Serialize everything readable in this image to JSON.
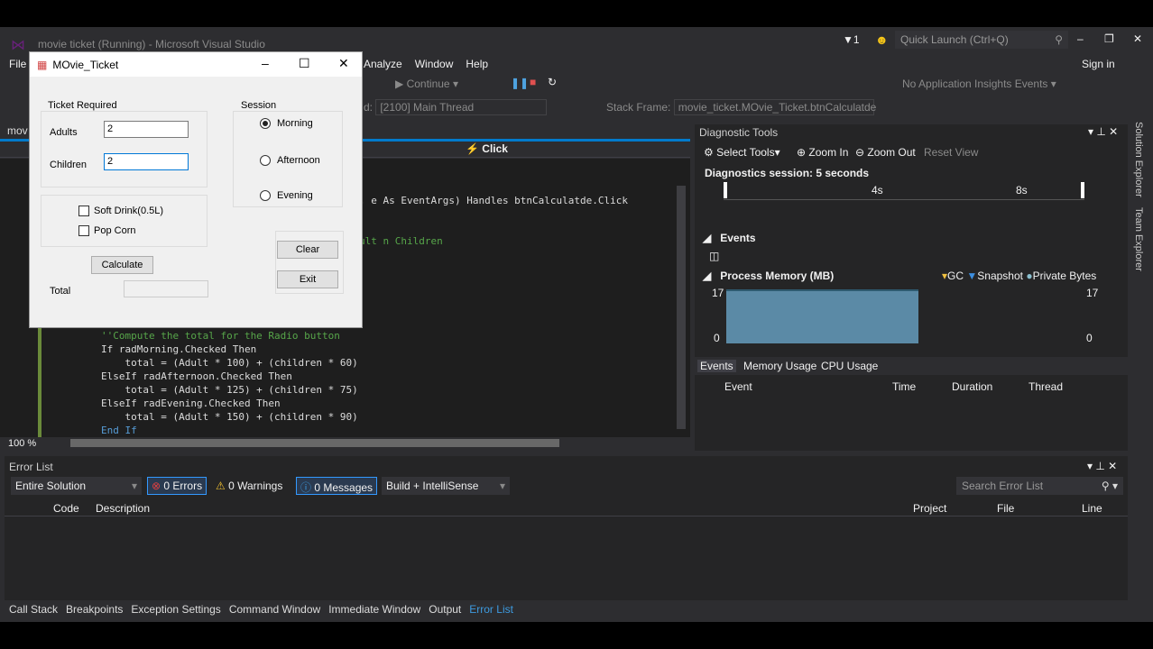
{
  "window": {
    "title": "movie ticket (Running) - Microsoft Visual Studio",
    "notifications": "1",
    "quick_launch": "Quick Launch (Ctrl+Q)",
    "sign_in": "Sign in"
  },
  "menu": [
    "File",
    "Analyze",
    "Window",
    "Help"
  ],
  "toolbar": {
    "continue": "Continue",
    "app_insights": "No Application Insights Events",
    "thread": "[2100] Main Thread",
    "stack_frame_label": "Stack Frame:",
    "stack_frame": "movie_ticket.MOvie_Ticket.btnCalculatde"
  },
  "editor": {
    "tab": "mov",
    "event": "Click",
    "zoom": "100 %",
    "lines": [
      {
        "t": ", e As EventArgs) Handles btnCalculatde.Click"
      },
      {
        "t": "ult n Children"
      },
      {
        "t": "''Compute the total for the Radio button"
      },
      {
        "t": "If radMorning.Checked Then"
      },
      {
        "t": "    total = (Adult * 100) + (children * 60)"
      },
      {
        "t": "ElseIf radAfternoon.Checked Then"
      },
      {
        "t": "    total = (Adult * 125) + (children * 75)"
      },
      {
        "t": "ElseIf radEvening.Checked Then"
      },
      {
        "t": "    total = (Adult * 150) + (children * 90)"
      },
      {
        "t": "End If"
      }
    ]
  },
  "form": {
    "title": "MOvie_Ticket",
    "ticket_group": "Ticket Required",
    "adults_label": "Adults",
    "adults": "2",
    "children_label": "Children",
    "children": "2",
    "session_group": "Session",
    "morning": "Morning",
    "afternoon": "Afternoon",
    "evening": "Evening",
    "soft_drink": "Soft Drink(0.5L)",
    "pop_corn": "Pop Corn",
    "calculate": "Calculate",
    "total_label": "Total",
    "total": "",
    "clear": "Clear",
    "exit": "Exit",
    "selected_session": "Morning"
  },
  "diag": {
    "title": "Diagnostic Tools",
    "select_tools": "Select Tools",
    "zoom_in": "Zoom In",
    "zoom_out": "Zoom Out",
    "reset_view": "Reset View",
    "session": "Diagnostics session: 5 seconds",
    "tick_4": "4s",
    "tick_8": "8s",
    "events": "Events",
    "memory": "Process Memory (MB)",
    "gc": "GC",
    "snapshot": "Snapshot",
    "private_bytes": "Private Bytes",
    "y_max": "17",
    "y_min": "0",
    "memory_color": "#5b8aa6",
    "tabs": [
      "Events",
      "Memory Usage",
      "CPU Usage"
    ],
    "columns": [
      "Event",
      "Time",
      "Duration",
      "Thread"
    ]
  },
  "side_tabs": [
    "Solution Explorer",
    "Team Explorer"
  ],
  "errors": {
    "title": "Error List",
    "scope": "Entire Solution",
    "errors": "0 Errors",
    "warnings": "0 Warnings",
    "messages": "0 Messages",
    "filter": "Build + IntelliSense",
    "search": "Search Error List",
    "columns": [
      "Code",
      "Description",
      "Project",
      "File",
      "Line"
    ]
  },
  "bottom_tabs": [
    "Call Stack",
    "Breakpoints",
    "Exception Settings",
    "Command Window",
    "Immediate Window",
    "Output",
    "Error List"
  ]
}
